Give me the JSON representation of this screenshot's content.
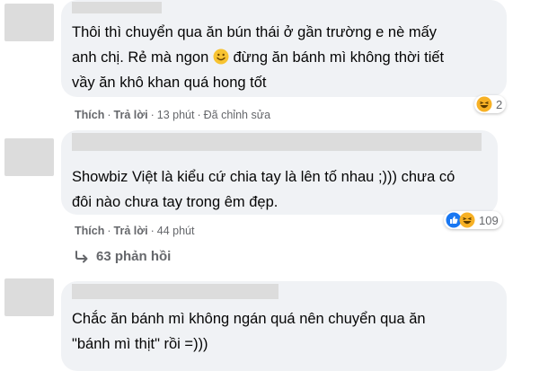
{
  "comments": [
    {
      "text_lines": [
        "Thôi thì chuyển qua ăn bún thái ở gần trường e nè mấy",
        "anh chị. Rẻ mà ngon",
        " đừng ăn bánh mì không thời tiết",
        "vầy ăn khô khan quá hong tốt"
      ],
      "actions": {
        "like": "Thích",
        "reply": "Trả lời",
        "time": "13 phút",
        "edited": "Đã chỉnh sửa"
      },
      "reaction_count": "2",
      "inline_emoji": "smiling-face-icon",
      "reaction_icons": [
        "haha-icon"
      ]
    },
    {
      "text_lines": [
        "Showbiz Việt là kiểu cứ chia tay là lên tố nhau ;))) chưa có",
        "đôi nào chưa tay trong êm đẹp."
      ],
      "actions": {
        "like": "Thích",
        "reply": "Trả lời",
        "time": "44 phút"
      },
      "reaction_count": "109",
      "reaction_icons": [
        "like-icon",
        "haha-icon"
      ]
    },
    {
      "text_lines": [
        "Chắc ăn bánh mì không ngán quá nên chuyển qua ăn",
        "\"bánh mì thịt\" rồi =)))"
      ]
    }
  ],
  "replies_link": "63 phản hồi",
  "colors": {
    "bubble": "#f0f2f5",
    "meta_text": "#65676b",
    "like_blue": "#1877f2",
    "haha_yellow": "#f7b125"
  }
}
